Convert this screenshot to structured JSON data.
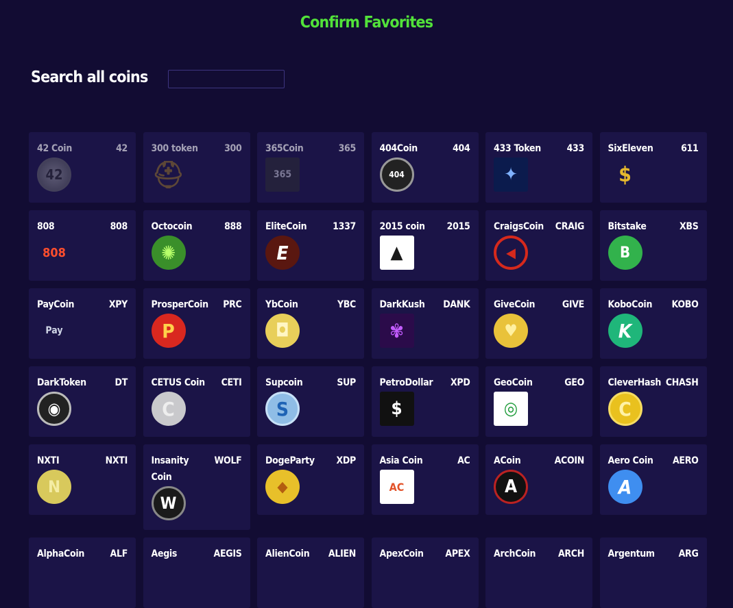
{
  "header": {
    "title": "Confirm Favorites"
  },
  "search": {
    "label": "Search all coins",
    "value": "",
    "placeholder": ""
  },
  "colors": {
    "background": "#120c33",
    "card": "#1b1447",
    "title": "#52e23a"
  },
  "coins": [
    {
      "name": "42 Coin",
      "symbol": "42",
      "icon": "coin-42-icon",
      "glyph": "42",
      "dim": true
    },
    {
      "name": "300 token",
      "symbol": "300",
      "icon": "spartan-helmet-icon",
      "glyph": "⛑",
      "dim": true
    },
    {
      "name": "365Coin",
      "symbol": "365",
      "icon": "coin-365-icon",
      "glyph": "365",
      "dim": true
    },
    {
      "name": "404Coin",
      "symbol": "404",
      "icon": "coin-404-icon",
      "glyph": "404",
      "dim": false
    },
    {
      "name": "433 Token",
      "symbol": "433",
      "icon": "network-globe-icon",
      "glyph": "✦",
      "dim": false
    },
    {
      "name": "SixEleven",
      "symbol": "611",
      "icon": "gold-stacks-icon",
      "glyph": "$",
      "dim": false
    },
    {
      "name": "808",
      "symbol": "808",
      "icon": "coin-808-icon",
      "glyph": "808",
      "dim": false
    },
    {
      "name": "Octocoin",
      "symbol": "888",
      "icon": "octopus-icon",
      "glyph": "✺",
      "dim": false
    },
    {
      "name": "EliteCoin",
      "symbol": "1337",
      "icon": "elite-e-icon",
      "glyph": "E",
      "dim": false
    },
    {
      "name": "2015 coin",
      "symbol": "2015",
      "icon": "triangle-flag-icon",
      "glyph": "▲",
      "dim": false
    },
    {
      "name": "CraigsCoin",
      "symbol": "CRAIG",
      "icon": "megaphone-icon",
      "glyph": "◀",
      "dim": false
    },
    {
      "name": "Bitstake",
      "symbol": "XBS",
      "icon": "bitstake-shield-icon",
      "glyph": "B",
      "dim": false
    },
    {
      "name": "PayCoin",
      "symbol": "XPY",
      "icon": "paycoin-logo-icon",
      "glyph": "Pay",
      "dim": false
    },
    {
      "name": "ProsperCoin",
      "symbol": "PRC",
      "icon": "prospercoin-p-icon",
      "glyph": "P",
      "dim": false
    },
    {
      "name": "YbCoin",
      "symbol": "YBC",
      "icon": "ybcoin-icon",
      "glyph": "◘",
      "dim": false
    },
    {
      "name": "DarkKush",
      "symbol": "DANK",
      "icon": "leaf-icon",
      "glyph": "✾",
      "dim": false
    },
    {
      "name": "GiveCoin",
      "symbol": "GIVE",
      "icon": "givecoin-heart-icon",
      "glyph": "♥",
      "dim": false
    },
    {
      "name": "KoboCoin",
      "symbol": "KOBO",
      "icon": "kobocoin-k-icon",
      "glyph": "K",
      "dim": false
    },
    {
      "name": "DarkToken",
      "symbol": "DT",
      "icon": "darktoken-eye-icon",
      "glyph": "◉",
      "dim": false
    },
    {
      "name": "CETUS Coin",
      "symbol": "CETI",
      "icon": "cetus-coin-icon",
      "glyph": "C",
      "dim": false
    },
    {
      "name": "Supcoin",
      "symbol": "SUP",
      "icon": "supcoin-s-icon",
      "glyph": "S",
      "dim": false
    },
    {
      "name": "PetroDollar",
      "symbol": "XPD",
      "icon": "oil-barrel-icon",
      "glyph": "$",
      "dim": false
    },
    {
      "name": "GeoCoin",
      "symbol": "GEO",
      "icon": "map-pin-icon",
      "glyph": "◎",
      "dim": false
    },
    {
      "name": "CleverHash",
      "symbol": "CHASH",
      "icon": "cleverhash-c-icon",
      "glyph": "C",
      "dim": false
    },
    {
      "name": "NXTI",
      "symbol": "NXTI",
      "icon": "nxti-coin-icon",
      "glyph": "N",
      "dim": false
    },
    {
      "name": "Insanity Coin",
      "symbol": "WOLF",
      "icon": "insanity-w-icon",
      "glyph": "W",
      "dim": false
    },
    {
      "name": "DogeParty",
      "symbol": "XDP",
      "icon": "doge-face-icon",
      "glyph": "◆",
      "dim": false
    },
    {
      "name": "Asia Coin",
      "symbol": "AC",
      "icon": "dragon-icon",
      "glyph": "AC",
      "dim": false
    },
    {
      "name": "ACoin",
      "symbol": "ACOIN",
      "icon": "acoin-a-icon",
      "glyph": "A",
      "dim": false
    },
    {
      "name": "Aero Coin",
      "symbol": "AERO",
      "icon": "aero-a-icon",
      "glyph": "A",
      "dim": false
    },
    {
      "name": "AlphaCoin",
      "symbol": "ALF",
      "icon": "alphacoin-icon",
      "glyph": "",
      "dim": false
    },
    {
      "name": "Aegis",
      "symbol": "AEGIS",
      "icon": "aegis-icon",
      "glyph": "",
      "dim": false
    },
    {
      "name": "AlienCoin",
      "symbol": "ALIEN",
      "icon": "aliencoin-icon",
      "glyph": "",
      "dim": false
    },
    {
      "name": "ApexCoin",
      "symbol": "APEX",
      "icon": "apexcoin-icon",
      "glyph": "",
      "dim": false
    },
    {
      "name": "ArchCoin",
      "symbol": "ARCH",
      "icon": "archcoin-icon",
      "glyph": "",
      "dim": false
    },
    {
      "name": "Argentum",
      "symbol": "ARG",
      "icon": "argentum-icon",
      "glyph": "",
      "dim": false
    }
  ]
}
